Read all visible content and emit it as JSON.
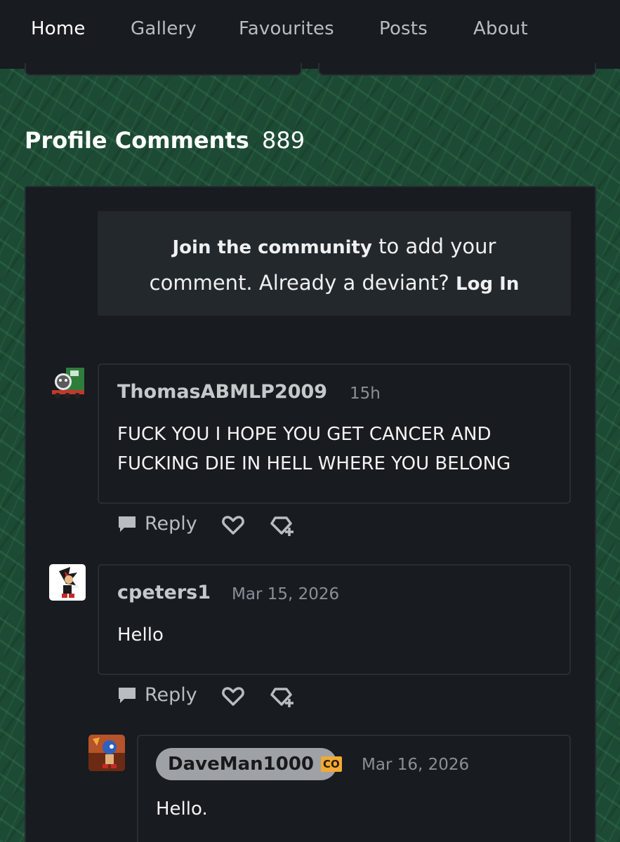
{
  "nav": {
    "items": [
      {
        "label": "Home",
        "active": true
      },
      {
        "label": "Gallery",
        "active": false
      },
      {
        "label": "Favourites",
        "active": false
      },
      {
        "label": "Posts",
        "active": false
      },
      {
        "label": "About",
        "active": false
      }
    ],
    "accent_color": "#59e0a3"
  },
  "section": {
    "title": "Profile Comments",
    "count": "889"
  },
  "join": {
    "cta_bold": "Join the community",
    "cta_text_1": " to add your",
    "cta_text_2": "comment. Already a deviant?",
    "login_label": "Log In"
  },
  "comments": [
    {
      "author": "ThomasABMLP2009",
      "time": "15h",
      "lines": [
        "FUCK YOU I HOPE YOU GET CANCER AND",
        "FUCKING DIE IN HELL WHERE YOU BELONG"
      ],
      "avatar_icon": "tank-engine-avatar"
    },
    {
      "author": "cpeters1",
      "time": "Mar 15, 2026",
      "lines": [
        "Hello"
      ],
      "avatar_icon": "hedgehog-avatar"
    },
    {
      "author": "DaveMan1000",
      "badge": "CO",
      "time": "Mar 16, 2026",
      "lines": [
        "Hello."
      ],
      "avatar_icon": "game-art-avatar"
    }
  ],
  "actions": {
    "reply_label": "Reply",
    "favourite_icon": "heart-icon",
    "award_icon": "badge-plus-icon"
  }
}
